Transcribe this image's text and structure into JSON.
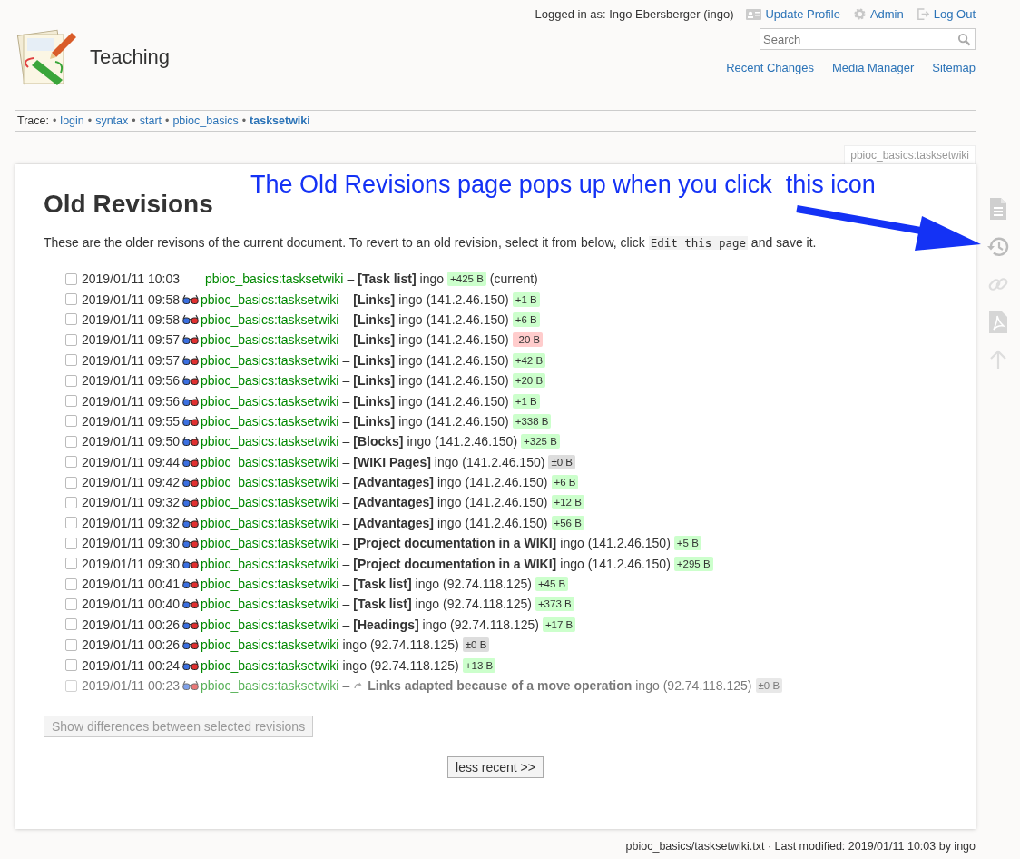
{
  "site": {
    "title": "Teaching"
  },
  "user_bar": {
    "logged_in": "Logged in as: Ingo Ebersberger (ingo)",
    "links": [
      {
        "kind": "profile",
        "label": "Update Profile"
      },
      {
        "kind": "admin",
        "label": "Admin"
      },
      {
        "kind": "logout",
        "label": "Log Out"
      }
    ]
  },
  "search": {
    "placeholder": "Search"
  },
  "nav": [
    "Recent Changes",
    "Media Manager",
    "Sitemap"
  ],
  "trace": {
    "label": "Trace:",
    "separator": "•",
    "items": [
      {
        "text": "login",
        "current": false
      },
      {
        "text": "syntax",
        "current": false
      },
      {
        "text": "start",
        "current": false
      },
      {
        "text": "pbioc_basics",
        "current": false
      },
      {
        "text": "tasksetwiki",
        "current": true
      }
    ]
  },
  "page_id": "pbioc_basics:tasksetwiki",
  "annotation": "The Old Revisions page pops up when you click  this icon",
  "title": "Old Revisions",
  "intro": {
    "before": "These are the older revisons of the current document. To revert to an old revision, select it from below, click",
    "code": "Edit this page",
    "after": "and save it."
  },
  "revisions": [
    {
      "checked": false,
      "date": "2019/01/11 10:03",
      "diff": false,
      "page": "pbioc_basics:tasksetwiki",
      "dash": "–",
      "summary": "[Task list]",
      "user": "ingo",
      "size": "+425 B",
      "color": "#ccffcc",
      "current": "(current)",
      "minor": false
    },
    {
      "checked": false,
      "date": "2019/01/11 09:58",
      "diff": true,
      "page": "pbioc_basics:tasksetwiki",
      "dash": "–",
      "summary": "[Links]",
      "user": "ingo",
      "ip": "(141.2.46.150)",
      "size": "+1 B",
      "color": "#ccffcc",
      "minor": false
    },
    {
      "checked": false,
      "date": "2019/01/11 09:58",
      "diff": true,
      "page": "pbioc_basics:tasksetwiki",
      "dash": "–",
      "summary": "[Links]",
      "user": "ingo",
      "ip": "(141.2.46.150)",
      "size": "+6 B",
      "color": "#ccffcc",
      "minor": false
    },
    {
      "checked": false,
      "date": "2019/01/11 09:57",
      "diff": true,
      "page": "pbioc_basics:tasksetwiki",
      "dash": "–",
      "summary": "[Links]",
      "user": "ingo",
      "ip": "(141.2.46.150)",
      "size": "-20 B",
      "color": "#ffcccc",
      "minor": false
    },
    {
      "checked": false,
      "date": "2019/01/11 09:57",
      "diff": true,
      "page": "pbioc_basics:tasksetwiki",
      "dash": "–",
      "summary": "[Links]",
      "user": "ingo",
      "ip": "(141.2.46.150)",
      "size": "+42 B",
      "color": "#ccffcc",
      "minor": false
    },
    {
      "checked": false,
      "date": "2019/01/11 09:56",
      "diff": true,
      "page": "pbioc_basics:tasksetwiki",
      "dash": "–",
      "summary": "[Links]",
      "user": "ingo",
      "ip": "(141.2.46.150)",
      "size": "+20 B",
      "color": "#ccffcc",
      "minor": false
    },
    {
      "checked": false,
      "date": "2019/01/11 09:56",
      "diff": true,
      "page": "pbioc_basics:tasksetwiki",
      "dash": "–",
      "summary": "[Links]",
      "user": "ingo",
      "ip": "(141.2.46.150)",
      "size": "+1 B",
      "color": "#ccffcc",
      "minor": false
    },
    {
      "checked": false,
      "date": "2019/01/11 09:55",
      "diff": true,
      "page": "pbioc_basics:tasksetwiki",
      "dash": "–",
      "summary": "[Links]",
      "user": "ingo",
      "ip": "(141.2.46.150)",
      "size": "+338 B",
      "color": "#ccffcc",
      "minor": false
    },
    {
      "checked": false,
      "date": "2019/01/11 09:50",
      "diff": true,
      "page": "pbioc_basics:tasksetwiki",
      "dash": "–",
      "summary": "[Blocks]",
      "user": "ingo",
      "ip": "(141.2.46.150)",
      "size": "+325 B",
      "color": "#ccffcc",
      "minor": false
    },
    {
      "checked": false,
      "date": "2019/01/11 09:44",
      "diff": true,
      "page": "pbioc_basics:tasksetwiki",
      "dash": "–",
      "summary": "[WIKI Pages]",
      "user": "ingo",
      "ip": "(141.2.46.150)",
      "size": "±0 B",
      "color": "#dddddd",
      "minor": false
    },
    {
      "checked": false,
      "date": "2019/01/11 09:42",
      "diff": true,
      "page": "pbioc_basics:tasksetwiki",
      "dash": "–",
      "summary": "[Advantages]",
      "user": "ingo",
      "ip": "(141.2.46.150)",
      "size": "+6 B",
      "color": "#ccffcc",
      "minor": false
    },
    {
      "checked": false,
      "date": "2019/01/11 09:32",
      "diff": true,
      "page": "pbioc_basics:tasksetwiki",
      "dash": "–",
      "summary": "[Advantages]",
      "user": "ingo",
      "ip": "(141.2.46.150)",
      "size": "+12 B",
      "color": "#ccffcc",
      "minor": false
    },
    {
      "checked": false,
      "date": "2019/01/11 09:32",
      "diff": true,
      "page": "pbioc_basics:tasksetwiki",
      "dash": "–",
      "summary": "[Advantages]",
      "user": "ingo",
      "ip": "(141.2.46.150)",
      "size": "+56 B",
      "color": "#ccffcc",
      "minor": false
    },
    {
      "checked": false,
      "date": "2019/01/11 09:30",
      "diff": true,
      "page": "pbioc_basics:tasksetwiki",
      "dash": "–",
      "summary": "[Project documentation in a WIKI]",
      "user": "ingo",
      "ip": "(141.2.46.150)",
      "size": "+5 B",
      "color": "#ccffcc",
      "minor": false
    },
    {
      "checked": false,
      "date": "2019/01/11 09:30",
      "diff": true,
      "page": "pbioc_basics:tasksetwiki",
      "dash": "–",
      "summary": "[Project documentation in a WIKI]",
      "user": "ingo",
      "ip": "(141.2.46.150)",
      "size": "+295 B",
      "color": "#ccffcc",
      "minor": false
    },
    {
      "checked": false,
      "date": "2019/01/11 00:41",
      "diff": true,
      "page": "pbioc_basics:tasksetwiki",
      "dash": "–",
      "summary": "[Task list]",
      "user": "ingo",
      "ip": "(92.74.118.125)",
      "size": "+45 B",
      "color": "#ccffcc",
      "minor": false
    },
    {
      "checked": false,
      "date": "2019/01/11 00:40",
      "diff": true,
      "page": "pbioc_basics:tasksetwiki",
      "dash": "–",
      "summary": "[Task list]",
      "user": "ingo",
      "ip": "(92.74.118.125)",
      "size": "+373 B",
      "color": "#ccffcc",
      "minor": false
    },
    {
      "checked": false,
      "date": "2019/01/11 00:26",
      "diff": true,
      "page": "pbioc_basics:tasksetwiki",
      "dash": "–",
      "summary": "[Headings]",
      "user": "ingo",
      "ip": "(92.74.118.125)",
      "size": "+17 B",
      "color": "#ccffcc",
      "minor": false
    },
    {
      "checked": false,
      "date": "2019/01/11 00:26",
      "diff": true,
      "page": "pbioc_basics:tasksetwiki",
      "user": "ingo",
      "ip": "(92.74.118.125)",
      "size": "±0 B",
      "color": "#dddddd",
      "minor": false
    },
    {
      "checked": false,
      "date": "2019/01/11 00:24",
      "diff": true,
      "page": "pbioc_basics:tasksetwiki",
      "user": "ingo",
      "ip": "(92.74.118.125)",
      "size": "+13 B",
      "color": "#ccffcc",
      "minor": false
    },
    {
      "checked": false,
      "date": "2019/01/11 00:23",
      "diff": true,
      "page": "pbioc_basics:tasksetwiki",
      "dash": "–",
      "summary": "Links adapted because of a move operation",
      "user": "ingo",
      "ip": "(92.74.118.125)",
      "size": "±0 B",
      "color": "#dddddd",
      "minor": true
    }
  ],
  "compare_button": {
    "label": "Show differences between selected revisions",
    "disabled": true
  },
  "pager_button": "less recent >>",
  "page_tools": [
    {
      "kind": "page"
    },
    {
      "kind": "revisions"
    },
    {
      "kind": "backlinks"
    },
    {
      "kind": "pdf"
    },
    {
      "kind": "top"
    }
  ],
  "footer": "pbioc_basics/tasksetwiki.txt · Last modified: 2019/01/11 10:03 by ingo"
}
